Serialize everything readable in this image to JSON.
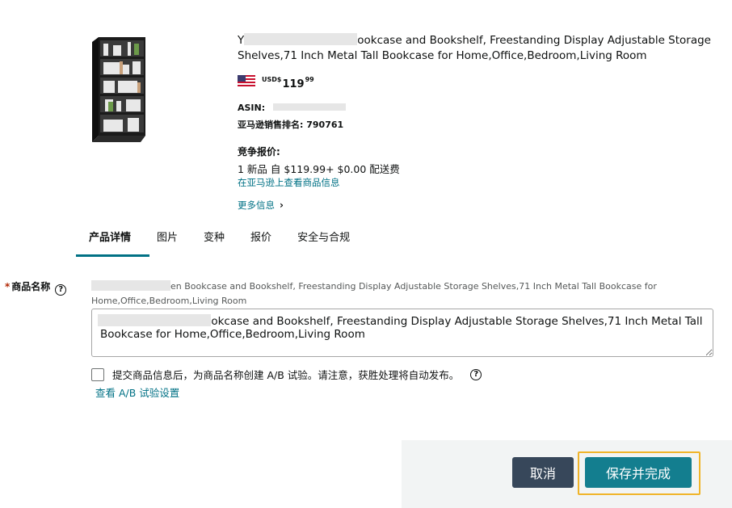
{
  "product": {
    "title_part1": "ookcase and Bookshelf, Freestanding Display Adjustable Storage",
    "title_part2": "Shelves,71 Inch Metal Tall Bookcase for Home,Office,Bedroom,Living Room",
    "title_prefix": "Y",
    "price_currency": "USD$",
    "price_whole": "119",
    "price_cents": "99",
    "asin_label": "ASIN:",
    "rank_label": "亚马逊销售排名:",
    "rank_value": "790761",
    "competitive_title": "竞争报价:",
    "competitive_line": "1 新品 自 $119.99+ $0.00 配送费",
    "view_on_amazon": "在亚马逊上查看商品信息",
    "more_info": "更多信息"
  },
  "tabs": [
    "产品详情",
    "图片",
    "变种",
    "报价",
    "安全与合规"
  ],
  "field": {
    "label": "商品名称",
    "required_mark": "*",
    "current_value_part": "en Bookcase and Bookshelf, Freestanding Display Adjustable Storage Shelves,71 Inch Metal Tall Bookcase for",
    "current_value_part2": "Home,Office,Bedroom,Living Room",
    "input_value": "Y                          Bookcase and Bookshelf, Freestanding Display Adjustable Storage Shelves,71 Inch Metal Tall Bookcase for Home,Office,Bedroom,Living Room",
    "ab_checkbox_label": "提交商品信息后，为商品名称创建 A/B 试验。请注意，获胜处理将自动发布。",
    "ab_link": "查看 A/B 试验设置"
  },
  "footer": {
    "cancel_label": "取消",
    "save_label": "保存并完成"
  },
  "colors": {
    "link": "#007185",
    "tab_active_underline": "#007185",
    "cancel_button": "#37475a",
    "save_button": "#137e8f",
    "focus_ring": "#f0b429",
    "required_star": "#b12704"
  }
}
